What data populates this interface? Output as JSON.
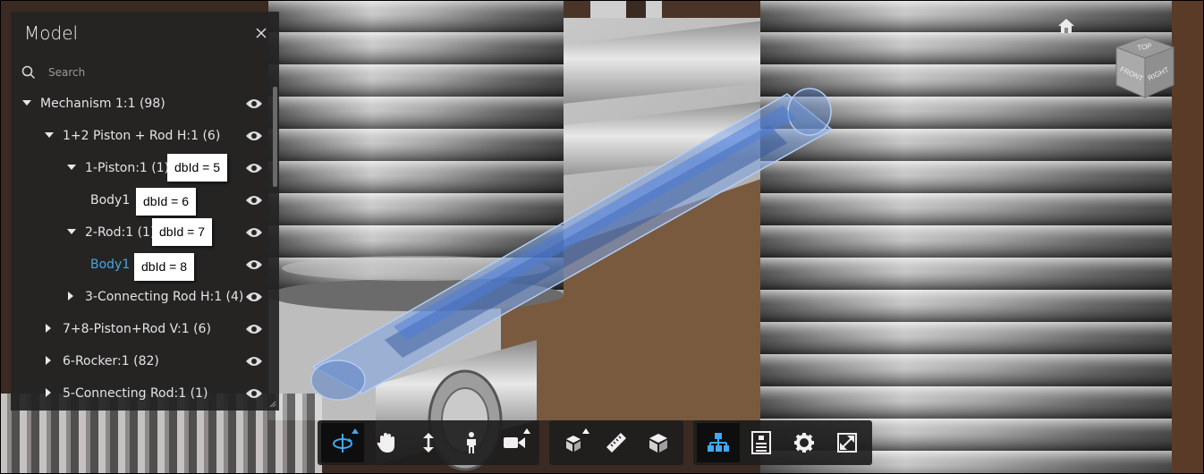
{
  "panel": {
    "title": "Model",
    "search_placeholder": "Search",
    "tree": [
      {
        "label": "Mechanism 1:1 (98)",
        "caret": "down"
      },
      {
        "label": "1+2 Piston + Rod H:1 (6)",
        "caret": "down"
      },
      {
        "label": "1-Piston:1 (1)",
        "caret": "down"
      },
      {
        "label": "Body1",
        "caret": ""
      },
      {
        "label": "2-Rod:1 (1)",
        "caret": "down"
      },
      {
        "label": "Body1",
        "caret": "",
        "selected": true
      },
      {
        "label": "3-Connecting Rod H:1 (4)",
        "caret": "right"
      },
      {
        "label": "7+8-Piston+Rod V:1 (6)",
        "caret": "right"
      },
      {
        "label": "6-Rocker:1 (82)",
        "caret": "right"
      },
      {
        "label": "5-Connecting Rod:1 (1)",
        "caret": "right"
      }
    ]
  },
  "annotations": {
    "dbid5": "dbId = 5",
    "dbid6": "dbId = 6",
    "dbid7": "dbId = 7",
    "dbid8": "dbId = 8"
  },
  "viewcube": {
    "top": "TOP",
    "front": "FRONT",
    "right": "RIGHT"
  },
  "toolbar": {
    "groups": [
      [
        "orbit-icon",
        "pan-hand-icon",
        "dolly-icon",
        "first-person-icon",
        "camera-icon"
      ],
      [
        "explode-model-icon",
        "measure-ruler-icon",
        "section-cube-icon"
      ],
      [
        "model-browser-icon",
        "properties-icon",
        "settings-gear-icon",
        "fullscreen-icon"
      ]
    ]
  },
  "colors": {
    "selection": "#4aa3df",
    "highlight_fill": "#7fa6e6",
    "active_icon": "#3fa9f5"
  }
}
